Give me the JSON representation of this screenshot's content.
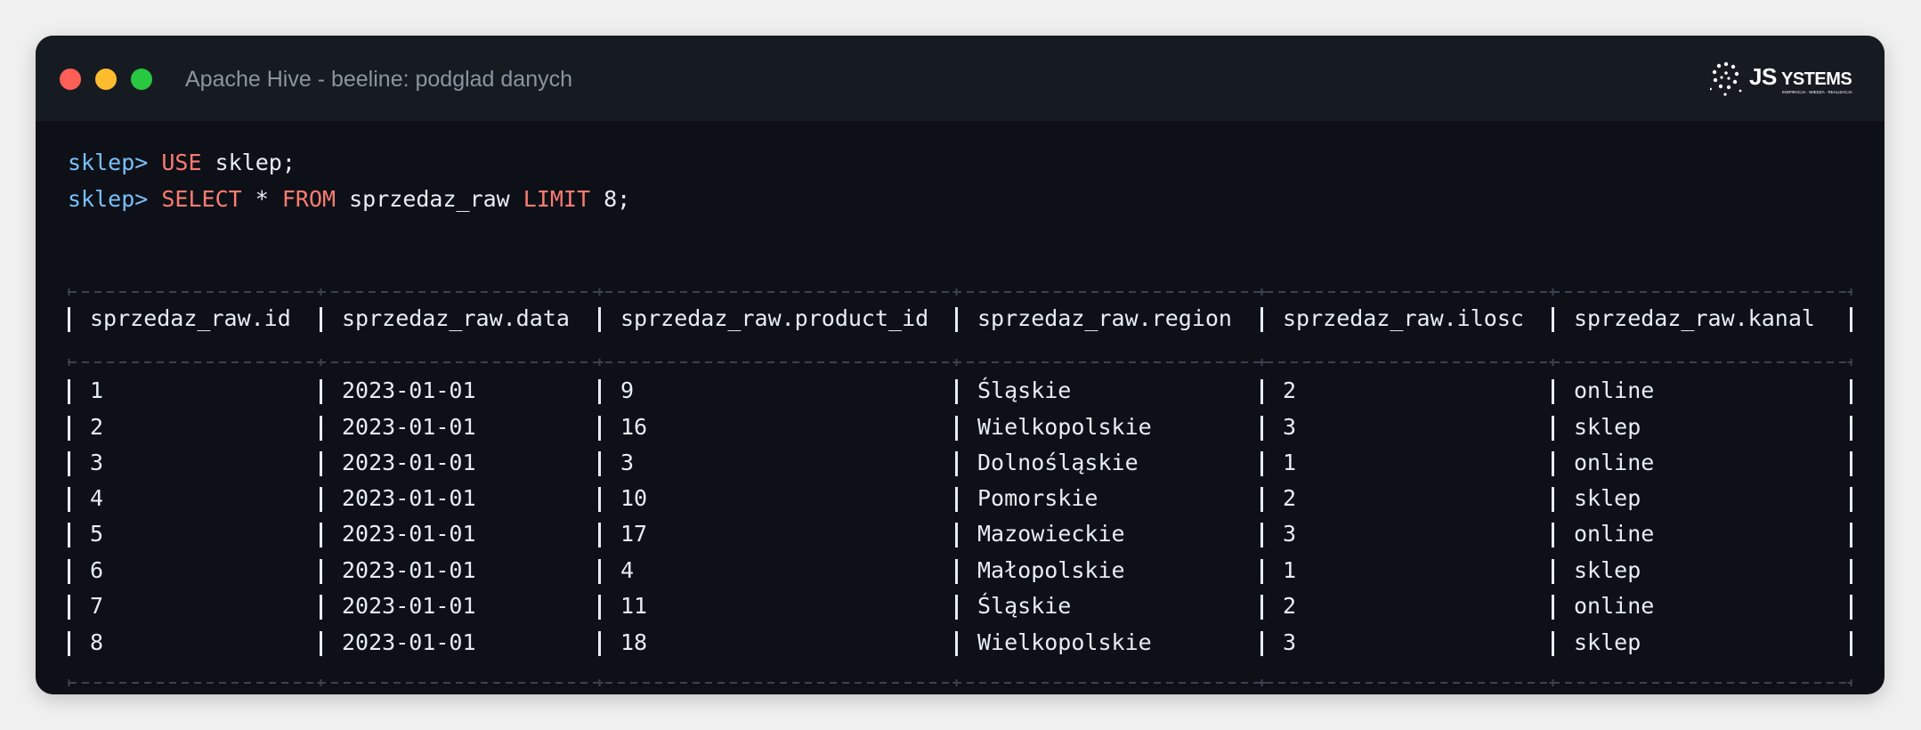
{
  "window": {
    "title": "Apache Hive - beeline: podglad danych",
    "logo_text": "JSYSTEMS",
    "logo_tagline": "INSPIRACJA · WIEDZA · REALIZACJA"
  },
  "terminal": {
    "commands": [
      {
        "prompt": "sklep>",
        "parts": [
          {
            "t": "USE",
            "kw": true
          },
          {
            "t": " sklep;",
            "kw": false
          }
        ]
      },
      {
        "prompt": "sklep>",
        "parts": [
          {
            "t": "SELECT",
            "kw": true
          },
          {
            "t": " * ",
            "kw": false
          },
          {
            "t": "FROM",
            "kw": true
          },
          {
            "t": " sprzedaz_raw ",
            "kw": false
          },
          {
            "t": "LIMIT",
            "kw": true
          },
          {
            "t": " 8;",
            "kw": false
          }
        ]
      }
    ],
    "table": {
      "headers": [
        "sprzedaz_raw.id",
        "sprzedaz_raw.data",
        "sprzedaz_raw.product_id",
        "sprzedaz_raw.region",
        "sprzedaz_raw.ilosc",
        "sprzedaz_raw.kanal"
      ],
      "rows": [
        [
          "1",
          "2023-01-01",
          "9",
          "Śląskie",
          "2",
          "online"
        ],
        [
          "2",
          "2023-01-01",
          "16",
          "Wielkopolskie",
          "3",
          "sklep"
        ],
        [
          "3",
          "2023-01-01",
          "3",
          "Dolnośląskie",
          "1",
          "online"
        ],
        [
          "4",
          "2023-01-01",
          "10",
          "Pomorskie",
          "2",
          "sklep"
        ],
        [
          "5",
          "2023-01-01",
          "17",
          "Mazowieckie",
          "3",
          "online"
        ],
        [
          "6",
          "2023-01-01",
          "4",
          "Małopolskie",
          "1",
          "sklep"
        ],
        [
          "7",
          "2023-01-01",
          "11",
          "Śląskie",
          "2",
          "online"
        ],
        [
          "8",
          "2023-01-01",
          "18",
          "Wielkopolskie",
          "3",
          "sklep"
        ]
      ]
    }
  },
  "colors": {
    "prompt": "#79c0ff",
    "keyword": "#ff7b72",
    "text": "#e6edf3",
    "border": "#3a4150",
    "window_bg": "#0d1117",
    "titlebar_bg": "#161b22"
  }
}
